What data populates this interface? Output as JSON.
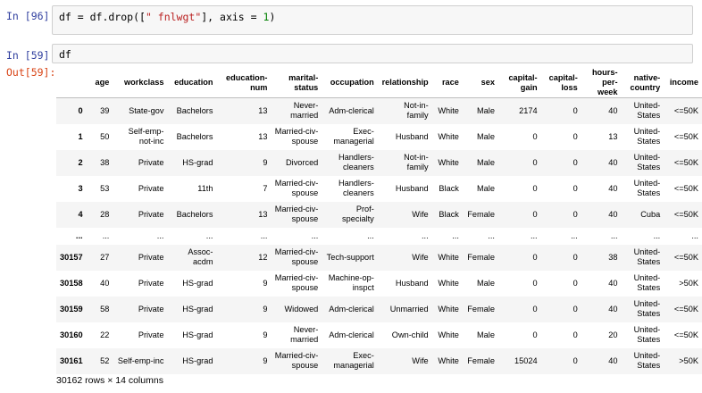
{
  "cells": [
    {
      "prompt": "In [96]:",
      "code_parts": [
        "df = df.drop([",
        "\" fnlwgt\"",
        "], axis = ",
        "1",
        ")"
      ]
    },
    {
      "prompt": "In [59]:",
      "code": "df",
      "out_prompt": "Out[59]:"
    }
  ],
  "dataframe": {
    "columns": [
      [
        "age"
      ],
      [
        "workclass"
      ],
      [
        "education"
      ],
      [
        "education-",
        "num"
      ],
      [
        "marital-",
        "status"
      ],
      [
        "occupation"
      ],
      [
        "relationship"
      ],
      [
        "race"
      ],
      [
        "sex"
      ],
      [
        "capital-",
        "gain"
      ],
      [
        "capital-",
        "loss"
      ],
      [
        "hours-",
        "per-week"
      ],
      [
        "native-",
        "country"
      ],
      [
        "income"
      ]
    ],
    "rows": [
      {
        "index": "0",
        "cells": [
          "39",
          [
            "State-gov"
          ],
          [
            "Bachelors"
          ],
          "13",
          [
            "Never-",
            "married"
          ],
          [
            "Adm-clerical"
          ],
          [
            "Not-in-",
            "family"
          ],
          "White",
          "Male",
          "2174",
          "0",
          "40",
          [
            "United-",
            "States"
          ],
          "<=50K"
        ]
      },
      {
        "index": "1",
        "cells": [
          "50",
          [
            "Self-emp-",
            "not-inc"
          ],
          [
            "Bachelors"
          ],
          "13",
          [
            "Married-civ-",
            "spouse"
          ],
          [
            "Exec-",
            "managerial"
          ],
          [
            "Husband"
          ],
          "White",
          "Male",
          "0",
          "0",
          "13",
          [
            "United-",
            "States"
          ],
          "<=50K"
        ]
      },
      {
        "index": "2",
        "cells": [
          "38",
          [
            "Private"
          ],
          [
            "HS-grad"
          ],
          "9",
          [
            "Divorced"
          ],
          [
            "Handlers-",
            "cleaners"
          ],
          [
            "Not-in-",
            "family"
          ],
          "White",
          "Male",
          "0",
          "0",
          "40",
          [
            "United-",
            "States"
          ],
          "<=50K"
        ]
      },
      {
        "index": "3",
        "cells": [
          "53",
          [
            "Private"
          ],
          [
            "11th"
          ],
          "7",
          [
            "Married-civ-",
            "spouse"
          ],
          [
            "Handlers-",
            "cleaners"
          ],
          [
            "Husband"
          ],
          "Black",
          "Male",
          "0",
          "0",
          "40",
          [
            "United-",
            "States"
          ],
          "<=50K"
        ]
      },
      {
        "index": "4",
        "cells": [
          "28",
          [
            "Private"
          ],
          [
            "Bachelors"
          ],
          "13",
          [
            "Married-civ-",
            "spouse"
          ],
          [
            "Prof-specialty"
          ],
          [
            "Wife"
          ],
          "Black",
          "Female",
          "0",
          "0",
          "40",
          [
            "Cuba"
          ],
          "<=50K"
        ]
      },
      {
        "index": "...",
        "ellipsis": true,
        "cells": [
          "...",
          [
            "..."
          ],
          [
            "..."
          ],
          "...",
          [
            "..."
          ],
          [
            "..."
          ],
          [
            "..."
          ],
          "...",
          "...",
          "...",
          "...",
          "...",
          [
            "..."
          ],
          "..."
        ]
      },
      {
        "index": "30157",
        "cells": [
          "27",
          [
            "Private"
          ],
          [
            "Assoc-",
            "acdm"
          ],
          "12",
          [
            "Married-civ-",
            "spouse"
          ],
          [
            "Tech-support"
          ],
          [
            "Wife"
          ],
          "White",
          "Female",
          "0",
          "0",
          "38",
          [
            "United-",
            "States"
          ],
          "<=50K"
        ]
      },
      {
        "index": "30158",
        "cells": [
          "40",
          [
            "Private"
          ],
          [
            "HS-grad"
          ],
          "9",
          [
            "Married-civ-",
            "spouse"
          ],
          [
            "Machine-op-",
            "inspct"
          ],
          [
            "Husband"
          ],
          "White",
          "Male",
          "0",
          "0",
          "40",
          [
            "United-",
            "States"
          ],
          ">50K"
        ]
      },
      {
        "index": "30159",
        "cells": [
          "58",
          [
            "Private"
          ],
          [
            "HS-grad"
          ],
          "9",
          [
            "Widowed"
          ],
          [
            "Adm-clerical"
          ],
          [
            "Unmarried"
          ],
          "White",
          "Female",
          "0",
          "0",
          "40",
          [
            "United-",
            "States"
          ],
          "<=50K"
        ]
      },
      {
        "index": "30160",
        "cells": [
          "22",
          [
            "Private"
          ],
          [
            "HS-grad"
          ],
          "9",
          [
            "Never-",
            "married"
          ],
          [
            "Adm-clerical"
          ],
          [
            "Own-child"
          ],
          "White",
          "Male",
          "0",
          "0",
          "20",
          [
            "United-",
            "States"
          ],
          "<=50K"
        ]
      },
      {
        "index": "30161",
        "cells": [
          "52",
          [
            "Self-emp-inc"
          ],
          [
            "HS-grad"
          ],
          "9",
          [
            "Married-civ-",
            "spouse"
          ],
          [
            "Exec-",
            "managerial"
          ],
          [
            "Wife"
          ],
          "White",
          "Female",
          "15024",
          "0",
          "40",
          [
            "United-",
            "States"
          ],
          ">50K"
        ]
      }
    ],
    "shape_text": "30162 rows × 14 columns"
  }
}
